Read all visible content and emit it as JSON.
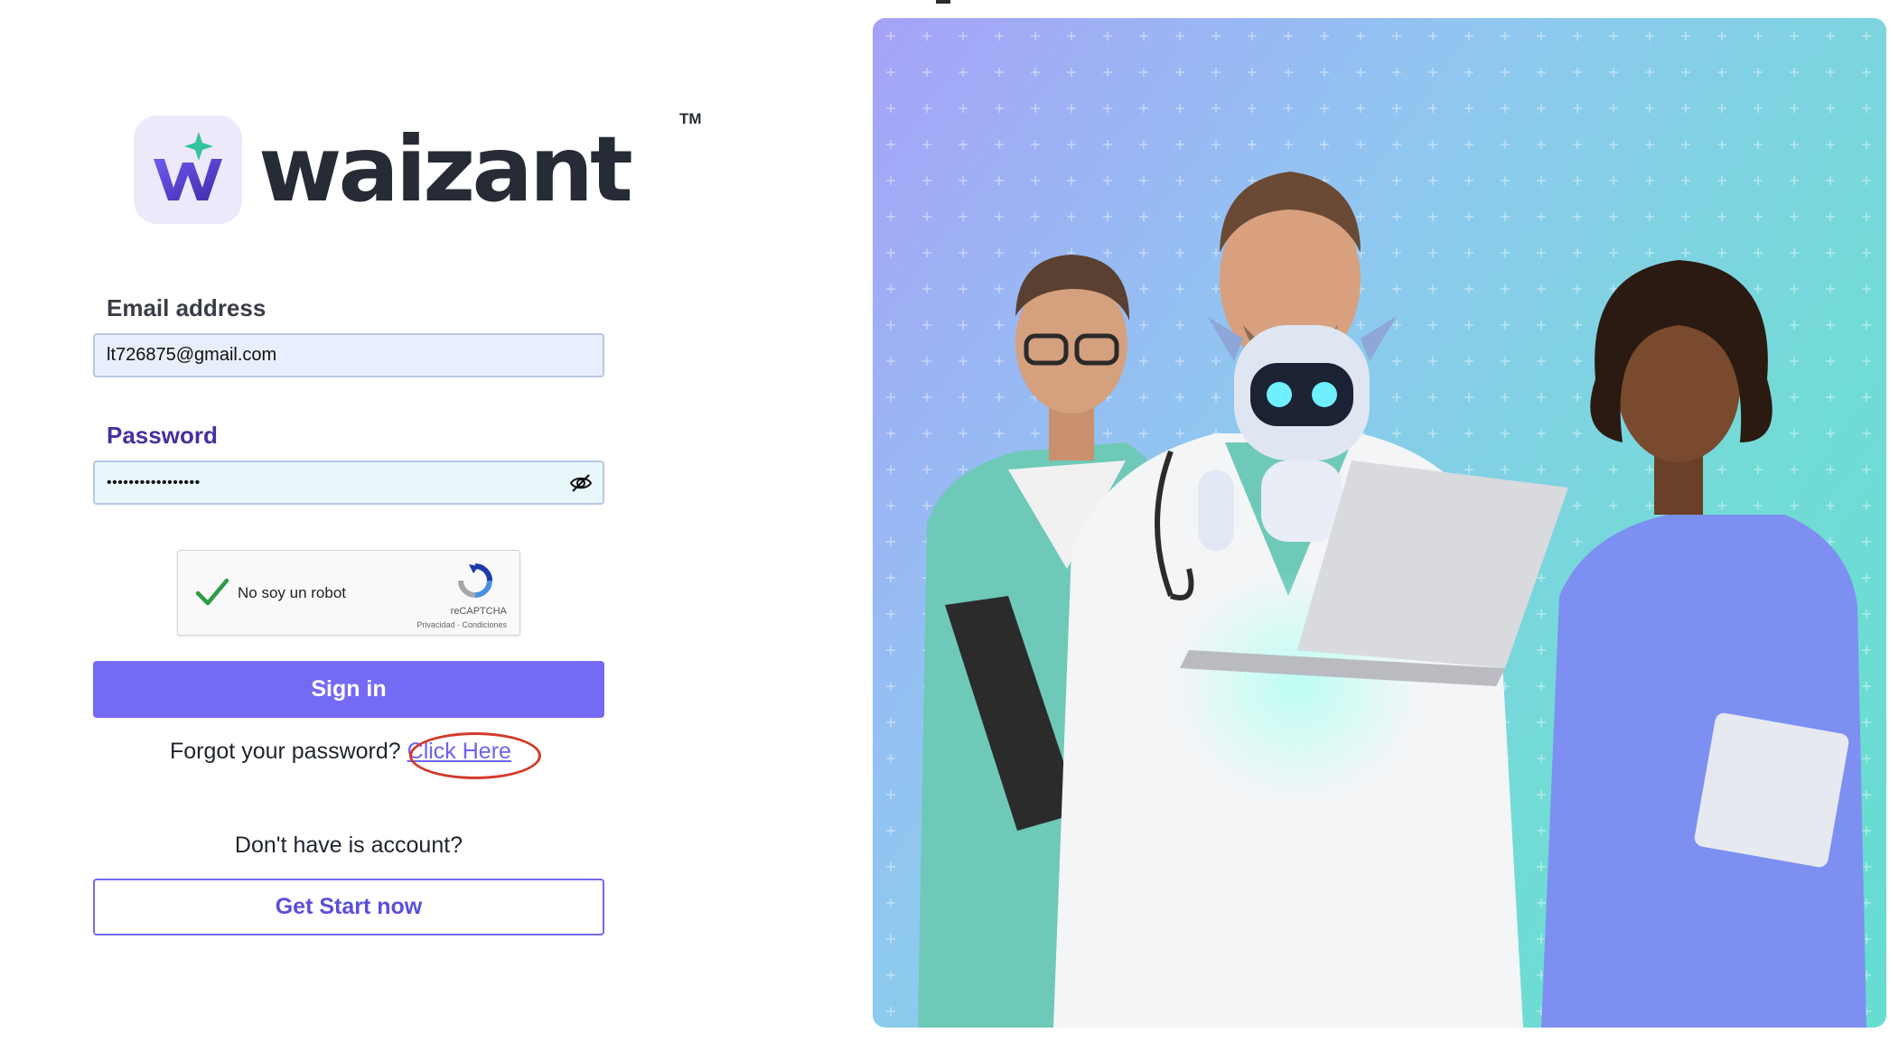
{
  "brand": {
    "name": "waizant",
    "trademark": "TM",
    "badge_letter": "w"
  },
  "form": {
    "email_label": "Email address",
    "email_value": "lt726875@gmail.com",
    "password_label": "Password",
    "password_mask": "•••••••••••••••••",
    "password_toggle_icon": "eye-slash-icon"
  },
  "captcha": {
    "label": "No soy un robot",
    "brand": "reCAPTCHA",
    "links": "Privacidad - Condiciones",
    "checked": true
  },
  "actions": {
    "signin_label": "Sign in",
    "forgot_text": "Forgot your password?",
    "forgot_link": "Click Here",
    "no_account_text": "Don't have is account?",
    "start_label": "Get Start now"
  },
  "colors": {
    "primary": "#746af3",
    "label_accent": "#47309c",
    "highlight_ring": "#d23b2c",
    "hero_gradient_start": "#a6a2f7",
    "hero_gradient_end": "#65ddd0"
  }
}
